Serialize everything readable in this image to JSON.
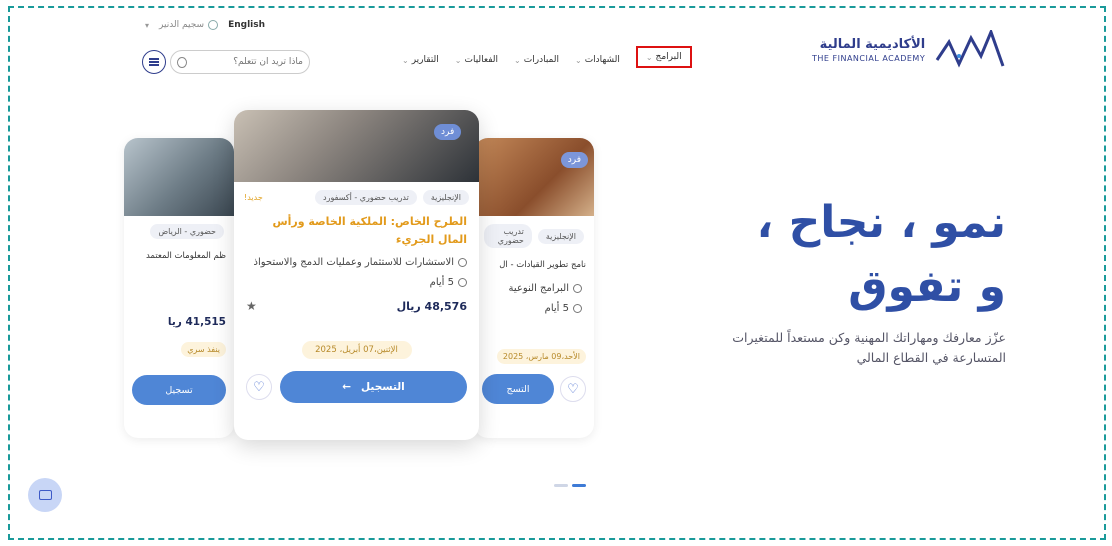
{
  "topbar": {
    "language": "English",
    "signin": "سجيم الدنير"
  },
  "search": {
    "placeholder": "ماذا تريد أن تتعلم؟"
  },
  "nav": {
    "items": [
      {
        "label": "البرامج",
        "active": true
      },
      {
        "label": "الشهادات",
        "active": false
      },
      {
        "label": "المبادرات",
        "active": false
      },
      {
        "label": "الفعاليات",
        "active": false
      },
      {
        "label": "التقارير",
        "active": false
      }
    ]
  },
  "logo": {
    "arabic": "الأكاديمية المالية",
    "english": "THE FINANCIAL ACADEMY"
  },
  "hero": {
    "title_line1": "نمو ، نجاح ،",
    "title_line2": "و تفوق",
    "subtitle": "عزّز معارفك ومهاراتك المهنية وكن مستعداً للمتغيرات المتسارعة في القطاع المالي"
  },
  "cards": {
    "main": {
      "badge": "فرد",
      "tag_language": "الإنجليزية",
      "tag_type": "تدريب حضوري - أكسفورد",
      "new_label": "جديد!",
      "title": "الطرح الخاص: الملكية الخاصة ورأس المال الجريء",
      "provider": "الاستشارات للاستثمار وعمليات الدمج والاستحواذ",
      "duration": "5 أيام",
      "price": "48,576 ريال",
      "date": "الإثنين،07 أبريل، 2025",
      "register": "التسجيل"
    },
    "left": {
      "tag": "حضوري - الرياض",
      "title": "ظم المعلومات المعتمد",
      "price": "41,515 ريا",
      "date": "ينفذ سري",
      "register": "تسجيل"
    },
    "right": {
      "badge": "فرد",
      "tag_language": "الإنجليزية",
      "tag_type": "تدريب حضوري",
      "title": "نامج تطوير القيادات - ال",
      "provider": "البرامج النوعية",
      "duration": "5 أيام",
      "date": "الأحد،09 مارس، 2025",
      "register": "التسج"
    }
  },
  "colors": {
    "accent": "#4f86d6",
    "brand": "#2f4fa5",
    "highlight": "#e29a1b"
  }
}
